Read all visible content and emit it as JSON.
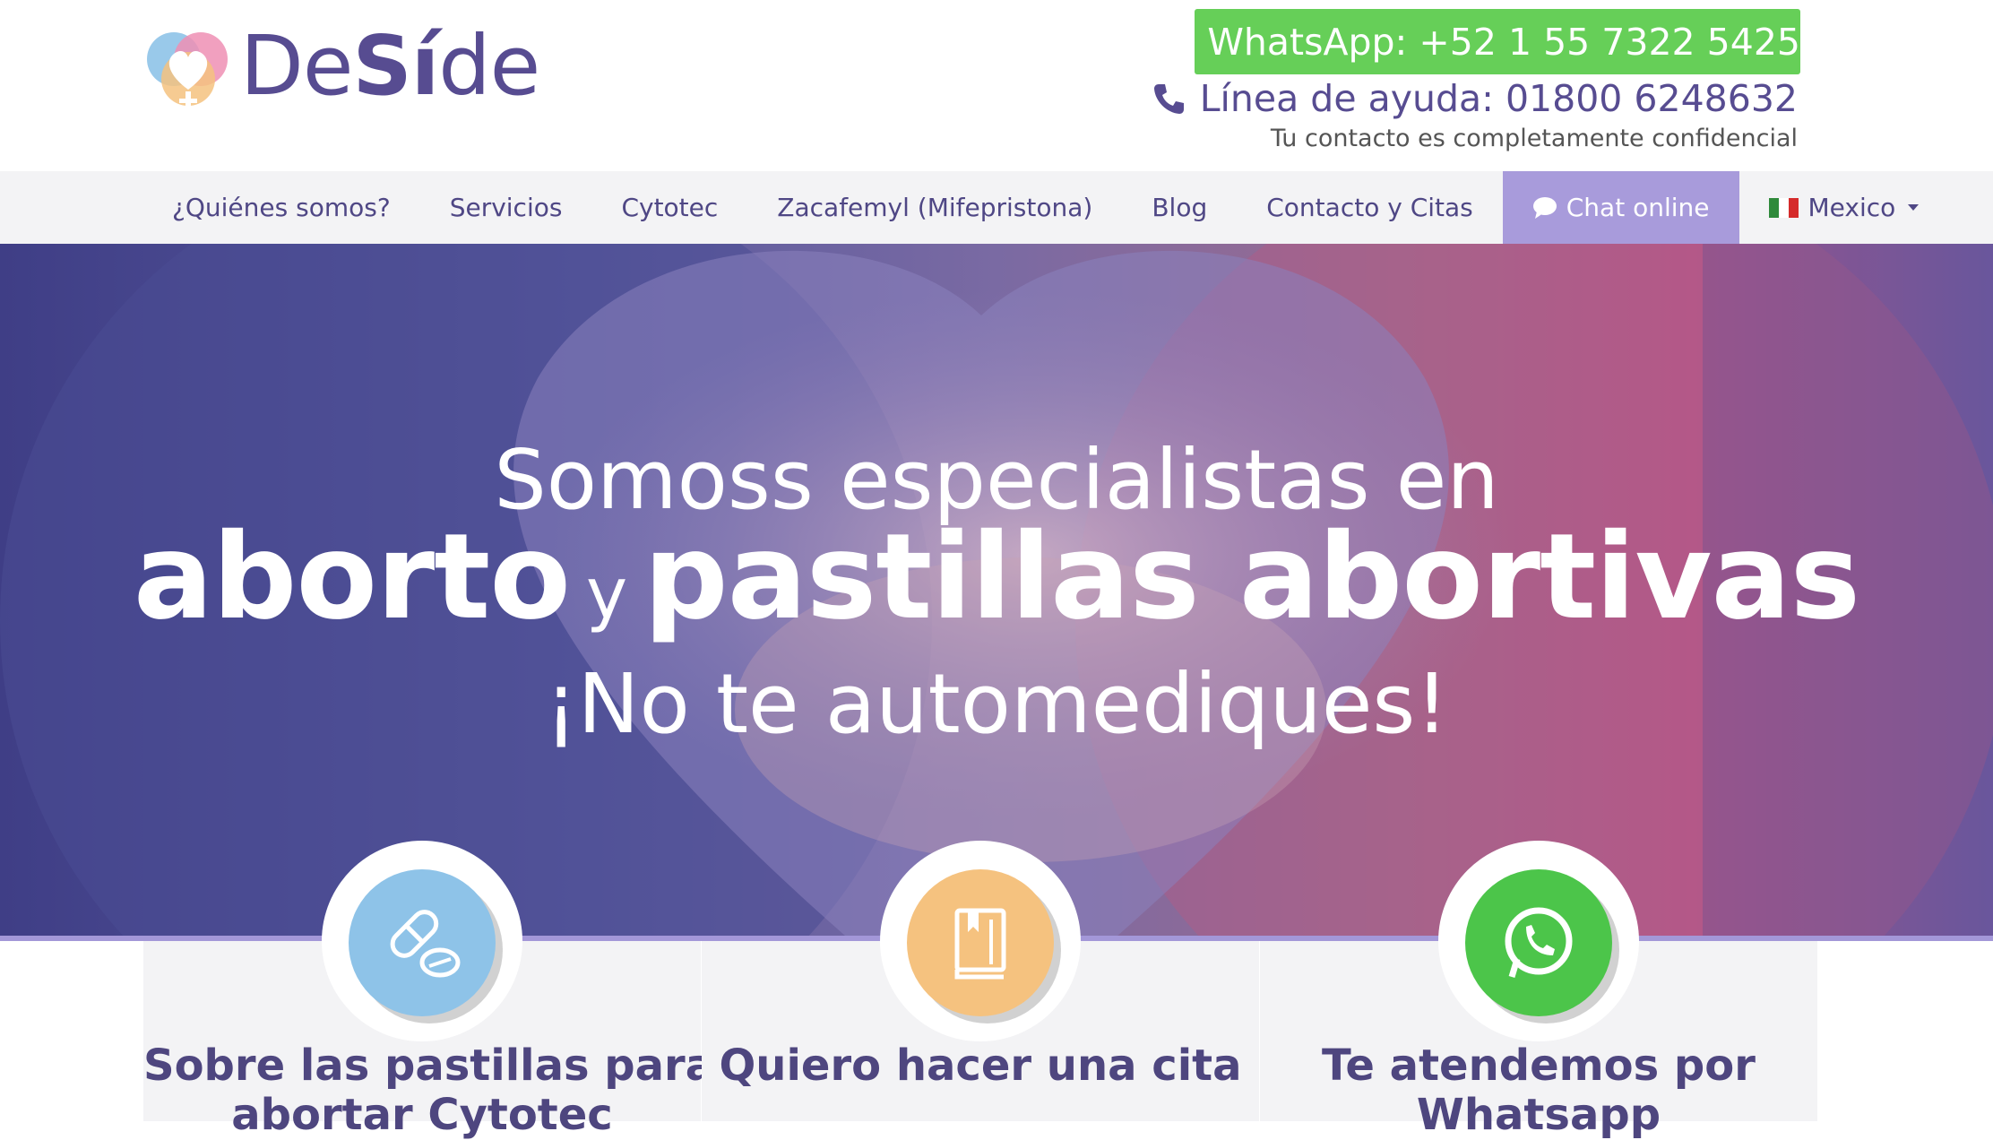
{
  "brand": {
    "name_prefix": "De",
    "name_bold": "Sí",
    "name_suffix": "de"
  },
  "header": {
    "whatsapp_label": "WhatsApp: +52 1 55 7322 5425",
    "helpline_label": "Línea de ayuda: 01800 6248632",
    "confidential_note": "Tu contacto es completamente confidencial"
  },
  "nav": {
    "items": [
      {
        "label": "¿Quiénes somos?"
      },
      {
        "label": "Servicios"
      },
      {
        "label": "Cytotec"
      },
      {
        "label": "Zacafemyl (Mifepristona)"
      },
      {
        "label": "Blog"
      },
      {
        "label": "Contacto y Citas"
      }
    ],
    "chat_label": "Chat online",
    "country_label": "Mexico"
  },
  "hero": {
    "line1": "Somoss especialistas en",
    "line2_a": "aborto",
    "line2_connector": "y",
    "line2_b": "pastillas abortivas",
    "line3": "¡No te automediques!"
  },
  "cards": [
    {
      "title_line1": "Sobre las pastillas para",
      "title_line2": "abortar Cytotec",
      "icon": "pills-icon",
      "color": "#8ec3e8"
    },
    {
      "title_line1": "Quiero hacer una cita",
      "title_line2": "",
      "icon": "book-icon",
      "color": "#f5c27f"
    },
    {
      "title_line1": "Te atendemos por",
      "title_line2": "Whatsapp",
      "icon": "whatsapp-icon",
      "color": "#4cc54a"
    }
  ],
  "colors": {
    "brand_purple": "#574c91",
    "whatsapp_green": "#66cf58",
    "chat_purple": "#a89bdb"
  }
}
